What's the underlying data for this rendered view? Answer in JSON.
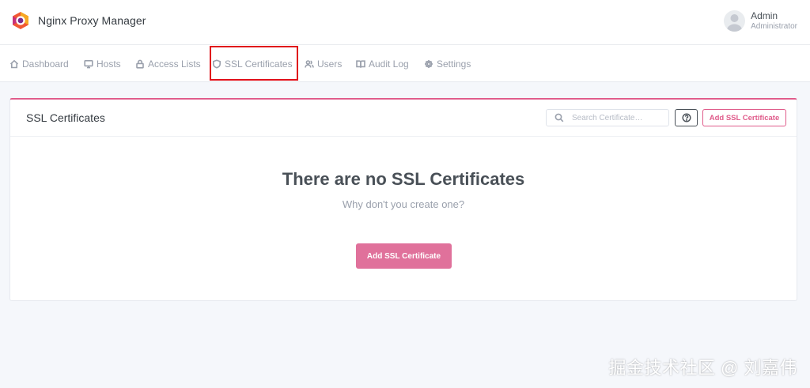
{
  "app": {
    "name": "Nginx Proxy Manager",
    "logo_icon": "npm-logo-icon"
  },
  "user": {
    "name": "Admin",
    "role": "Administrator",
    "avatar_icon": "user-avatar-icon"
  },
  "nav": {
    "items": [
      {
        "label": "Dashboard",
        "icon": "home-icon"
      },
      {
        "label": "Hosts",
        "icon": "monitor-icon"
      },
      {
        "label": "Access Lists",
        "icon": "lock-icon"
      },
      {
        "label": "SSL Certificates",
        "icon": "shield-icon",
        "highlighted": true
      },
      {
        "label": "Users",
        "icon": "users-icon"
      },
      {
        "label": "Audit Log",
        "icon": "book-icon"
      },
      {
        "label": "Settings",
        "icon": "settings-icon"
      }
    ]
  },
  "card": {
    "title": "SSL Certificates",
    "search": {
      "placeholder": "Search Certificate…",
      "value": ""
    },
    "help_icon": "help-circle-icon",
    "add_button_label": "Add SSL Certificate",
    "empty": {
      "title": "There are no SSL Certificates",
      "subtitle": "Why don't you create one?",
      "button_label": "Add SSL Certificate"
    }
  },
  "watermark": "掘金技术社区 @ 刘嘉伟",
  "colors": {
    "accent": "#e05c8b",
    "highlight_box": "#e0101a",
    "background": "#f5f7fb"
  }
}
